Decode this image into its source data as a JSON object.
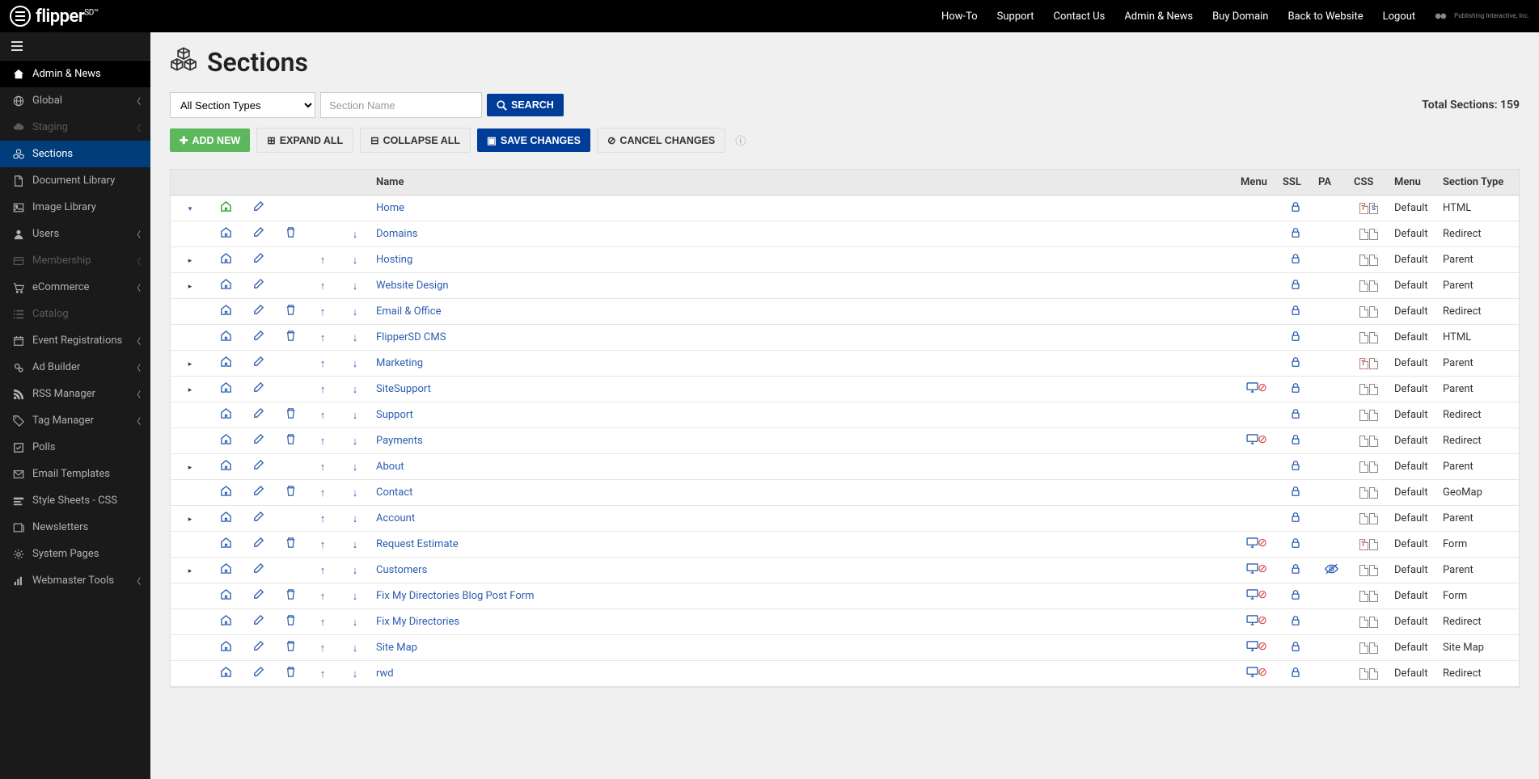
{
  "topnav": [
    "How-To",
    "Support",
    "Contact Us",
    "Admin & News",
    "Buy Domain",
    "Back to Website",
    "Logout"
  ],
  "brand": "flipper",
  "brandSup": "SD™",
  "footerBrand": "Publishing Interactive, Inc.",
  "sidebar": [
    {
      "label": "Admin & News",
      "icon": "home",
      "chev": false,
      "cls": "active-dark"
    },
    {
      "label": "Global",
      "icon": "globe",
      "chev": true
    },
    {
      "label": "Staging",
      "icon": "cloud",
      "chev": true,
      "cls": "disabled"
    },
    {
      "label": "Sections",
      "icon": "cubes",
      "chev": false,
      "cls": "active-blue"
    },
    {
      "label": "Document Library",
      "icon": "doc",
      "chev": false
    },
    {
      "label": "Image Library",
      "icon": "image",
      "chev": false
    },
    {
      "label": "Users",
      "icon": "user",
      "chev": true
    },
    {
      "label": "Membership",
      "icon": "card",
      "chev": true,
      "cls": "disabled"
    },
    {
      "label": "eCommerce",
      "icon": "cart",
      "chev": true
    },
    {
      "label": "Catalog",
      "icon": "list",
      "chev": false,
      "cls": "disabled"
    },
    {
      "label": "Event Registrations",
      "icon": "calendar",
      "chev": true
    },
    {
      "label": "Ad Builder",
      "icon": "gears",
      "chev": true
    },
    {
      "label": "RSS Manager",
      "icon": "rss",
      "chev": true
    },
    {
      "label": "Tag Manager",
      "icon": "tag",
      "chev": true
    },
    {
      "label": "Polls",
      "icon": "check",
      "chev": false
    },
    {
      "label": "Email Templates",
      "icon": "mail",
      "chev": false
    },
    {
      "label": "Style Sheets - CSS",
      "icon": "css",
      "chev": false
    },
    {
      "label": "Newsletters",
      "icon": "news",
      "chev": false
    },
    {
      "label": "System Pages",
      "icon": "gear",
      "chev": false
    },
    {
      "label": "Webmaster Tools",
      "icon": "chart",
      "chev": true
    }
  ],
  "page": {
    "title": "Sections",
    "selectLabel": "All Section Types",
    "searchPlaceholder": "Section Name",
    "searchBtn": "SEARCH",
    "totalLabelPrefix": "Total Sections: ",
    "totalCount": "159",
    "addNew": "ADD NEW",
    "expandAll": "EXPAND ALL",
    "collapseAll": "COLLAPSE ALL",
    "saveChanges": "SAVE CHANGES",
    "cancelChanges": "CANCEL CHANGES"
  },
  "columns": [
    "",
    "",
    "",
    "",
    "",
    "",
    "Name",
    "Menu",
    "SSL",
    "PA",
    "CSS",
    "Menu",
    "Section Type"
  ],
  "rows": [
    {
      "exp": "▾",
      "home": "green",
      "del": false,
      "up": false,
      "down": false,
      "name": "Home",
      "menuOff": false,
      "pa": false,
      "css": "ts",
      "menu": "Default",
      "type": "HTML"
    },
    {
      "exp": "",
      "home": "blue",
      "del": true,
      "up": false,
      "down": true,
      "name": "Domains",
      "menuOff": false,
      "pa": false,
      "css": "dd",
      "menu": "Default",
      "type": "Redirect"
    },
    {
      "exp": "▸",
      "home": "blue",
      "del": false,
      "up": true,
      "down": true,
      "name": "Hosting",
      "menuOff": false,
      "pa": false,
      "css": "dd",
      "menu": "Default",
      "type": "Parent"
    },
    {
      "exp": "▸",
      "home": "blue",
      "del": false,
      "up": true,
      "down": true,
      "name": "Website Design",
      "menuOff": false,
      "pa": false,
      "css": "dd",
      "menu": "Default",
      "type": "Parent"
    },
    {
      "exp": "",
      "home": "blue",
      "del": true,
      "up": true,
      "down": true,
      "name": "Email & Office",
      "menuOff": false,
      "pa": false,
      "css": "dd",
      "menu": "Default",
      "type": "Redirect"
    },
    {
      "exp": "",
      "home": "blue",
      "del": true,
      "up": true,
      "down": true,
      "name": "FlipperSD CMS",
      "menuOff": false,
      "pa": false,
      "css": "dd",
      "menu": "Default",
      "type": "HTML"
    },
    {
      "exp": "▸",
      "home": "blue",
      "del": false,
      "up": true,
      "down": true,
      "name": "Marketing",
      "menuOff": false,
      "pa": false,
      "css": "td",
      "menu": "Default",
      "type": "Parent"
    },
    {
      "exp": "▸",
      "home": "blue",
      "del": false,
      "up": true,
      "down": true,
      "name": "SiteSupport",
      "menuOff": true,
      "pa": false,
      "css": "dd",
      "menu": "Default",
      "type": "Parent"
    },
    {
      "exp": "",
      "home": "blue",
      "del": true,
      "up": true,
      "down": true,
      "name": "Support",
      "menuOff": false,
      "pa": false,
      "css": "dd",
      "menu": "Default",
      "type": "Redirect"
    },
    {
      "exp": "",
      "home": "blue",
      "del": true,
      "up": true,
      "down": true,
      "name": "Payments",
      "menuOff": true,
      "pa": false,
      "css": "dd",
      "menu": "Default",
      "type": "Redirect"
    },
    {
      "exp": "▸",
      "home": "blue",
      "del": false,
      "up": true,
      "down": true,
      "name": "About",
      "menuOff": false,
      "pa": false,
      "css": "dd",
      "menu": "Default",
      "type": "Parent"
    },
    {
      "exp": "",
      "home": "blue",
      "del": true,
      "up": true,
      "down": true,
      "name": "Contact",
      "menuOff": false,
      "pa": false,
      "css": "dd",
      "menu": "Default",
      "type": "GeoMap"
    },
    {
      "exp": "▸",
      "home": "blue",
      "del": false,
      "up": true,
      "down": true,
      "name": "Account",
      "menuOff": false,
      "pa": false,
      "css": "dd",
      "menu": "Default",
      "type": "Parent"
    },
    {
      "exp": "",
      "home": "blue",
      "del": true,
      "up": true,
      "down": true,
      "name": "Request Estimate",
      "menuOff": true,
      "pa": false,
      "css": "td",
      "menu": "Default",
      "type": "Form"
    },
    {
      "exp": "▸",
      "home": "blue",
      "del": false,
      "up": true,
      "down": true,
      "name": "Customers",
      "menuOff": true,
      "pa": true,
      "css": "dd",
      "menu": "Default",
      "type": "Parent"
    },
    {
      "exp": "",
      "home": "blue",
      "del": true,
      "up": true,
      "down": true,
      "name": "Fix My Directories Blog Post Form",
      "menuOff": true,
      "pa": false,
      "css": "dd",
      "menu": "Default",
      "type": "Form"
    },
    {
      "exp": "",
      "home": "blue",
      "del": true,
      "up": true,
      "down": true,
      "name": "Fix My Directories",
      "menuOff": true,
      "pa": false,
      "css": "dd",
      "menu": "Default",
      "type": "Redirect"
    },
    {
      "exp": "",
      "home": "blue",
      "del": true,
      "up": true,
      "down": true,
      "name": "Site Map",
      "menuOff": true,
      "pa": false,
      "css": "dd",
      "menu": "Default",
      "type": "Site Map"
    },
    {
      "exp": "",
      "home": "blue",
      "del": true,
      "up": true,
      "down": true,
      "name": "rwd",
      "menuOff": true,
      "pa": false,
      "css": "dd",
      "menu": "Default",
      "type": "Redirect"
    }
  ]
}
